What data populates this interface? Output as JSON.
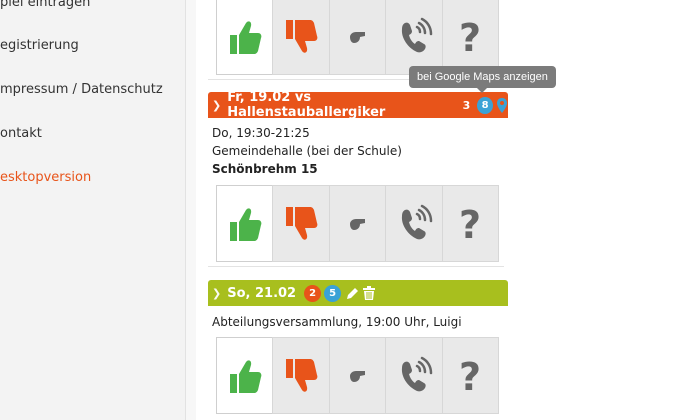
{
  "sidebar": {
    "items": [
      {
        "label": "piel eintragen"
      },
      {
        "label": "egistrierung"
      },
      {
        "label": "mpressum / Datenschutz"
      },
      {
        "label": "ontakt"
      },
      {
        "label": "esktopversion"
      }
    ]
  },
  "tooltip": {
    "text": "bei Google Maps anzeigen"
  },
  "events": [
    {
      "header_color": "#e8541a",
      "title": "Fr, 19.02 vs Hallenstauballergiker",
      "count_text": "3",
      "bubbles": [
        {
          "value": "8",
          "color": "#3aa2d6"
        }
      ],
      "icons": [
        "map-pin-icon"
      ],
      "time": "Do, 19:30-21:25",
      "venue": "Gemeindehalle (bei der Schule)",
      "address": "Schönbrehm 15"
    },
    {
      "header_color": "#a8bf1e",
      "title": "So, 21.02",
      "bubbles": [
        {
          "value": "2",
          "color": "#e8541a"
        },
        {
          "value": "5",
          "color": "#3aa2d6"
        }
      ],
      "icons": [
        "pencil-icon",
        "trash-icon"
      ],
      "description": "Abteilungsversammlung, 19:00 Uhr, Luigi"
    }
  ],
  "vote_options": [
    "thumbs-up-icon",
    "thumbs-down-icon",
    "whistle-icon",
    "phone-icon",
    "question-icon"
  ],
  "colors": {
    "up": "#4cb34a",
    "down": "#e8541a",
    "neutral": "#666666"
  }
}
